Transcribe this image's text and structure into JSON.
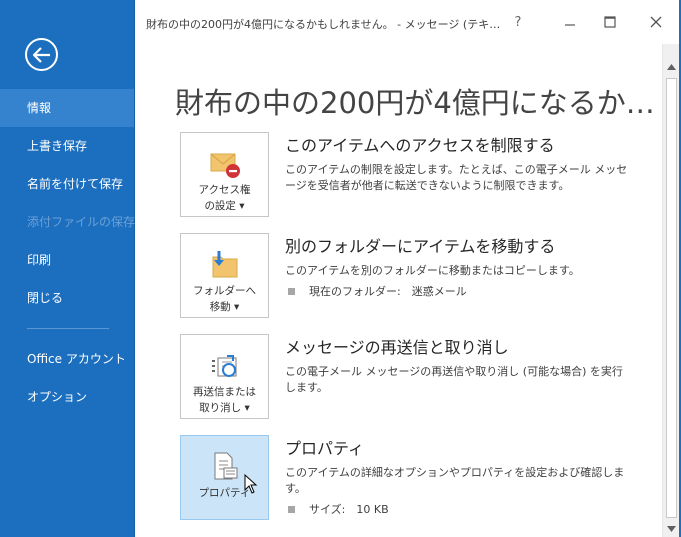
{
  "window": {
    "title": "財布の中の200円が4億円になるかもしれません。 - メッセージ (テキ…",
    "help": "?",
    "minimize": "─",
    "maximize": "☐",
    "close": "✕"
  },
  "sidebar": {
    "items": [
      {
        "label": "情報",
        "state": "active"
      },
      {
        "label": "上書き保存",
        "state": "normal"
      },
      {
        "label": "名前を付けて保存",
        "state": "normal"
      },
      {
        "label": "添付ファイルの保存",
        "state": "disabled"
      },
      {
        "label": "印刷",
        "state": "normal"
      },
      {
        "label": "閉じる",
        "state": "normal"
      },
      {
        "label": "Office アカウント",
        "state": "normal"
      },
      {
        "label": "オプション",
        "state": "normal"
      }
    ]
  },
  "main": {
    "page_title": "財布の中の200円が4億円になるか…",
    "sections": [
      {
        "tile_label_1": "アクセス権",
        "tile_label_2": "の設定 ▾",
        "icon": "envelope-restrict-icon",
        "heading": "このアイテムへのアクセスを制限する",
        "description": "このアイテムの制限を設定します。たとえば、この電子メール メッセージを受信者が他者に転送できないように制限できます。"
      },
      {
        "tile_label_1": "フォルダーへ",
        "tile_label_2": "移動 ▾",
        "icon": "move-to-folder-icon",
        "heading": "別のフォルダーにアイテムを移動する",
        "description": "このアイテムを別のフォルダーに移動またはコピーします。",
        "bullet": "現在のフォルダー:　迷惑メール"
      },
      {
        "tile_label_1": "再送信または",
        "tile_label_2": "取り消し ▾",
        "icon": "resend-recall-icon",
        "heading": "メッセージの再送信と取り消し",
        "description": "この電子メール メッセージの再送信や取り消し (可能な場合) を実行します。"
      },
      {
        "tile_label_1": "プロパティ",
        "tile_label_2": "",
        "icon": "properties-icon",
        "heading": "プロパティ",
        "description": "このアイテムの詳細なオプションやプロパティを設定および確認します。",
        "bullet": "サイズ:　10 KB"
      }
    ]
  },
  "colors": {
    "sidebar_bg": "#1c6fbf",
    "sidebar_active": "#3583cf",
    "tile_selected": "#cce4f7"
  }
}
